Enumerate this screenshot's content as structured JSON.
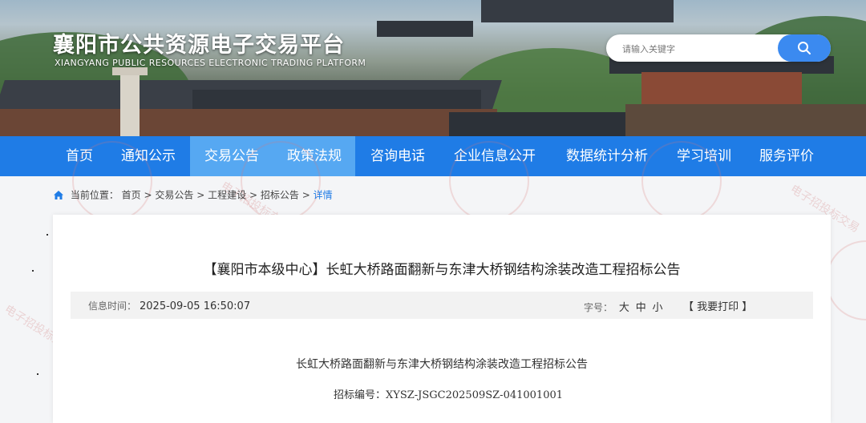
{
  "header": {
    "title": "襄阳市公共资源电子交易平台",
    "subtitle": "XIANGYANG PUBLIC RESOURCES ELECTRONIC TRADING PLATFORM"
  },
  "search": {
    "placeholder": "请输入关键字",
    "icon": "search-icon"
  },
  "nav": {
    "items": [
      {
        "label": "首页"
      },
      {
        "label": "通知公示"
      },
      {
        "label": "交易公告",
        "active": true
      },
      {
        "label": "政策法规",
        "active": true
      },
      {
        "label": "咨询电话"
      },
      {
        "label": "企业信息公开"
      },
      {
        "label": "数据统计分析"
      },
      {
        "label": "学习培训"
      },
      {
        "label": "服务评价"
      }
    ]
  },
  "breadcrumb": {
    "prefix": "当前位置：",
    "items": [
      "首页",
      "交易公告",
      "工程建设",
      "招标公告",
      "详情"
    ],
    "separator": ">"
  },
  "article": {
    "title": "【襄阳市本级中心】长虹大桥路面翻新与东津大桥钢结构涂装改造工程招标公告",
    "time_label": "信息时间：",
    "time_value": "2025-09-05 16:50:07",
    "font_label": "字号：",
    "font_sizes": [
      "大",
      "中",
      "小"
    ],
    "print_label": "【 我要打印 】",
    "body_title": "长虹大桥路面翻新与东津大桥钢结构涂装改造工程招标公告",
    "body_code": "招标编号：XYSZ-JSGC202509SZ-041001001"
  },
  "watermark": {
    "text": "电子招投标交易"
  },
  "colors": {
    "nav": "#1f7ce6",
    "nav_active": "#56a8f2",
    "search_button": "#3b8af0",
    "breadcrumb_current": "#1f7ce6"
  }
}
